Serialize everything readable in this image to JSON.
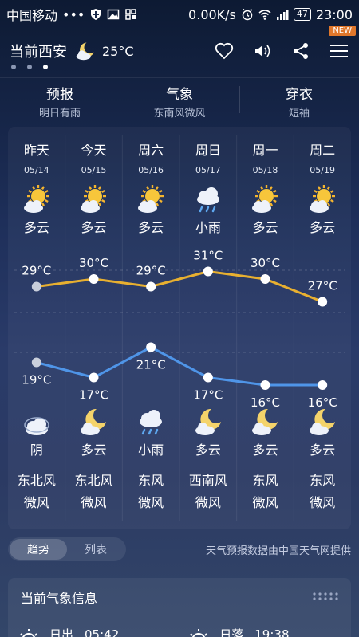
{
  "status": {
    "carrier": "中国移动",
    "dots": "•••",
    "net_speed": "0.00K/s",
    "battery": "47",
    "time": "23:00"
  },
  "badge": "NEW",
  "header": {
    "city": "当前西安",
    "current_temp": "25°C",
    "current_icon": "moon-cloud-icon"
  },
  "info_tabs": [
    {
      "title": "预报",
      "sub": "明日有雨"
    },
    {
      "title": "气象",
      "sub": "东南风微风"
    },
    {
      "title": "穿衣",
      "sub": "短袖"
    }
  ],
  "days": [
    {
      "name": "昨天",
      "date": "05/14",
      "day_weather": "多云",
      "day_icon": "sun-cloud-icon",
      "night_weather": "阴",
      "night_icon": "overcast-icon",
      "wind_dir": "东北风",
      "wind_lvl": "微风",
      "high": 29,
      "low": 19
    },
    {
      "name": "今天",
      "date": "05/15",
      "day_weather": "多云",
      "day_icon": "sun-cloud-icon",
      "night_weather": "多云",
      "night_icon": "moon-cloud-icon",
      "wind_dir": "东北风",
      "wind_lvl": "微风",
      "high": 30,
      "low": 17
    },
    {
      "name": "周六",
      "date": "05/16",
      "day_weather": "多云",
      "day_icon": "sun-cloud-icon",
      "night_weather": "小雨",
      "night_icon": "rain-cloud-icon",
      "wind_dir": "东风",
      "wind_lvl": "微风",
      "high": 29,
      "low": 21
    },
    {
      "name": "周日",
      "date": "05/17",
      "day_weather": "小雨",
      "day_icon": "rain-cloud-icon",
      "night_weather": "多云",
      "night_icon": "moon-cloud-icon",
      "wind_dir": "西南风",
      "wind_lvl": "微风",
      "high": 31,
      "low": 17
    },
    {
      "name": "周一",
      "date": "05/18",
      "day_weather": "多云",
      "day_icon": "sun-cloud-icon",
      "night_weather": "多云",
      "night_icon": "moon-cloud-icon",
      "wind_dir": "东风",
      "wind_lvl": "微风",
      "high": 30,
      "low": 16
    },
    {
      "name": "周二",
      "date": "05/19",
      "day_weather": "多云",
      "day_icon": "sun-cloud-icon",
      "night_weather": "多云",
      "night_icon": "moon-cloud-icon",
      "wind_dir": "东风",
      "wind_lvl": "微风",
      "high": 27,
      "low": 16
    }
  ],
  "chart_data": {
    "type": "line",
    "categories": [
      "昨天",
      "今天",
      "周六",
      "周日",
      "周一",
      "周二"
    ],
    "series": [
      {
        "values": [
          29,
          30,
          29,
          31,
          30,
          27
        ],
        "color": "#e8b030"
      },
      {
        "values": [
          19,
          17,
          21,
          17,
          16,
          16
        ],
        "color": "#4f95e8"
      }
    ],
    "unit": "°C"
  },
  "bottom": {
    "tab_trend": "趋势",
    "tab_list": "列表",
    "source": "天气预报数据由中国天气网提供"
  },
  "current_info": {
    "title": "当前气象信息",
    "sunrise_label": "日出",
    "sunrise_time": "05:42",
    "sunset_label": "日落",
    "sunset_time": "19:38"
  },
  "colors": {
    "high_line": "#e8b030",
    "low_line": "#4f95e8",
    "accent_badge": "#e0772b"
  }
}
